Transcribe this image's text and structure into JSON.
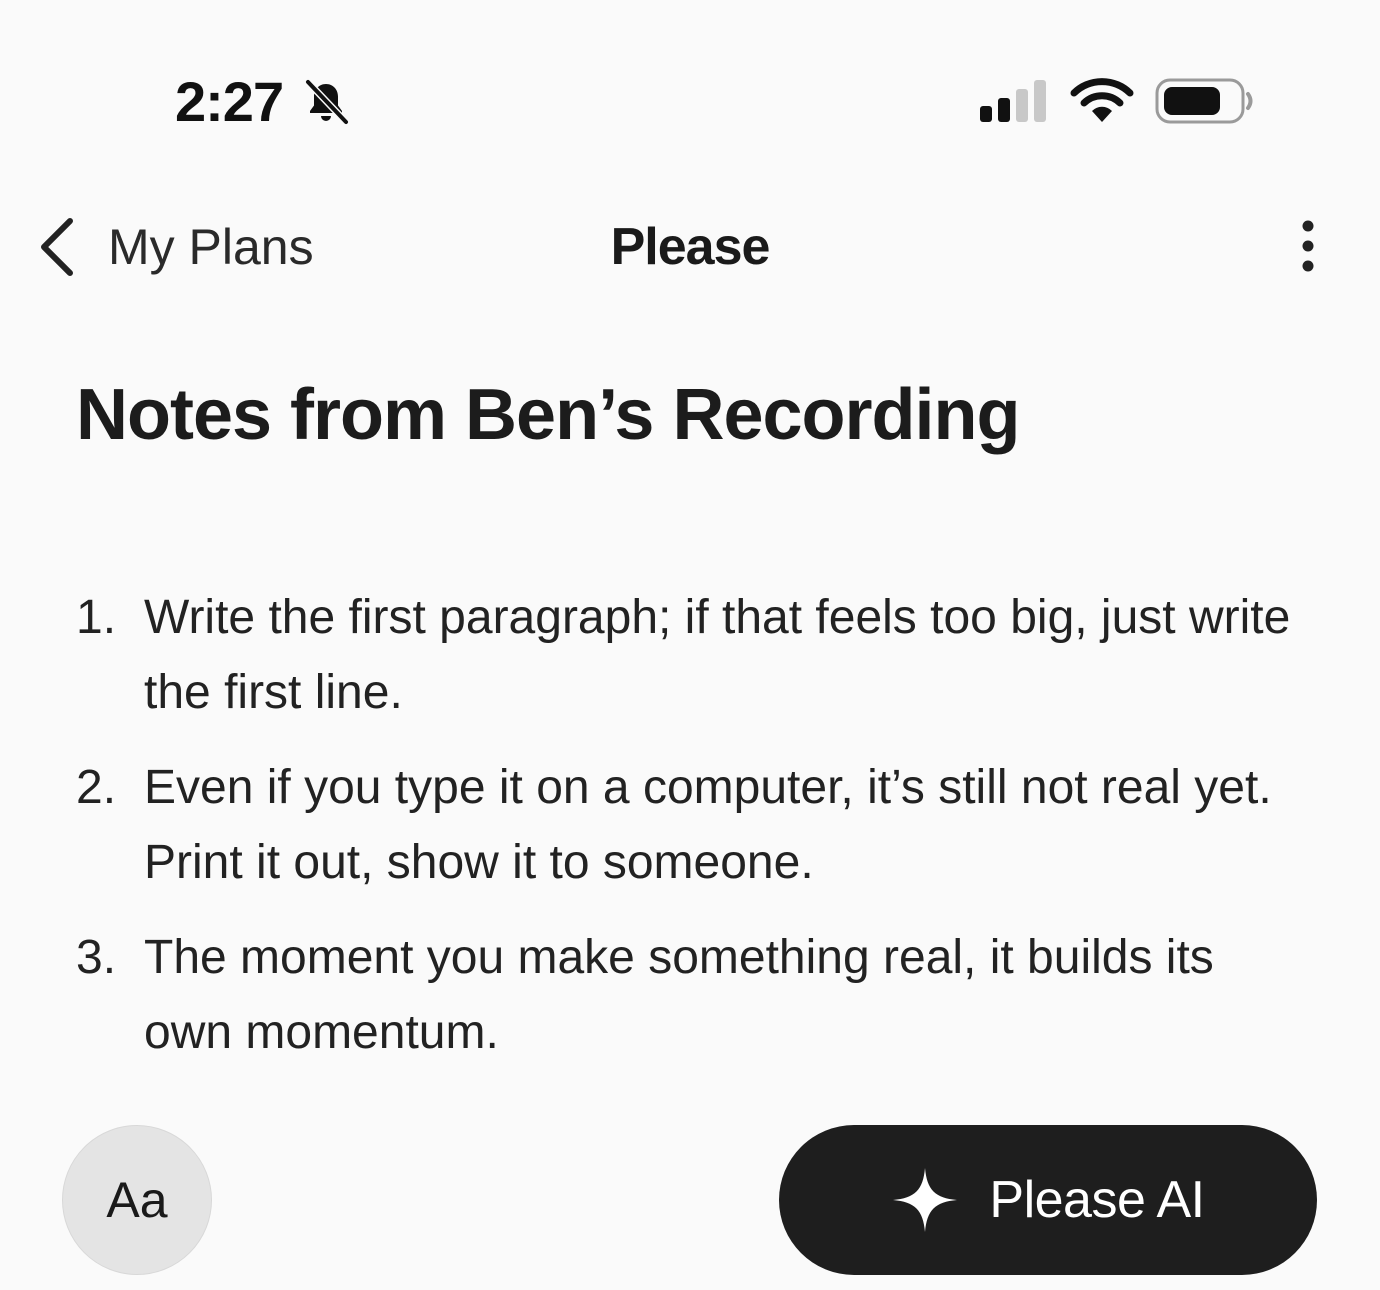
{
  "status_bar": {
    "time": "2:27",
    "bell_icon": "bell-slash-icon",
    "signal_icon": "cellular-signal-icon",
    "wifi_icon": "wifi-icon",
    "battery_icon": "battery-icon"
  },
  "nav": {
    "back_label": "My Plans",
    "back_icon": "chevron-left-icon",
    "title": "Please",
    "more_icon": "vertical-ellipsis-icon"
  },
  "note": {
    "title": "Notes from Ben’s Recording",
    "items": [
      {
        "number": "1.",
        "text": "Write the first paragraph; if that feels too big, just write the first line."
      },
      {
        "number": "2.",
        "text": "Even if you type it on a computer, it’s still not real yet. Print it out, show it to someone."
      },
      {
        "number": "3.",
        "text": "The moment you make something real, it builds its own momentum."
      }
    ]
  },
  "bottom": {
    "font_button_label": "Aa",
    "ai_button_label": "Please AI",
    "ai_icon": "sparkle-icon"
  },
  "colors": {
    "background": "#fafafa",
    "ai_button_bg": "#1e1e1e",
    "font_button_bg": "#e4e4e4",
    "text": "#1c1c1c"
  }
}
